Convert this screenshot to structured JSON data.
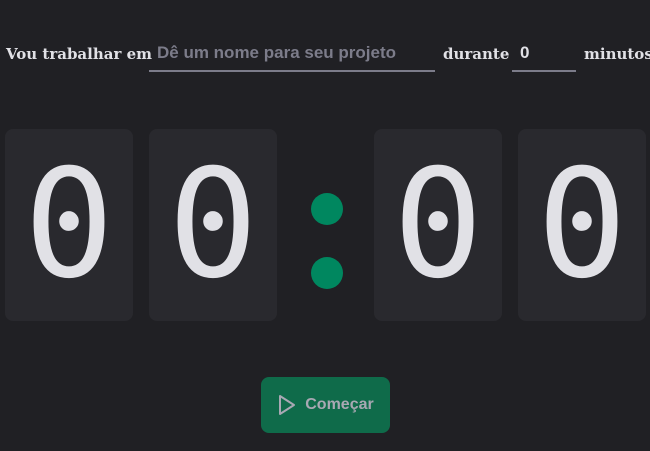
{
  "form": {
    "intro_label": "Vou trabalhar em",
    "task_placeholder": "Dê um nome para seu projeto",
    "task_value": "",
    "during_label": "durante",
    "minutes_value": "0",
    "minutes_label": "minutos"
  },
  "countdown": {
    "digits": [
      "0",
      "0",
      "0",
      "0"
    ],
    "separator": ":"
  },
  "actions": {
    "start_label": "Começar",
    "start_icon": "play-icon"
  },
  "colors": {
    "background": "#202024",
    "digit_box": "#29292e",
    "accent": "#00875f",
    "button": "#0f6b4a",
    "text": "#e1e1e6",
    "placeholder": "#7c7c8a"
  }
}
